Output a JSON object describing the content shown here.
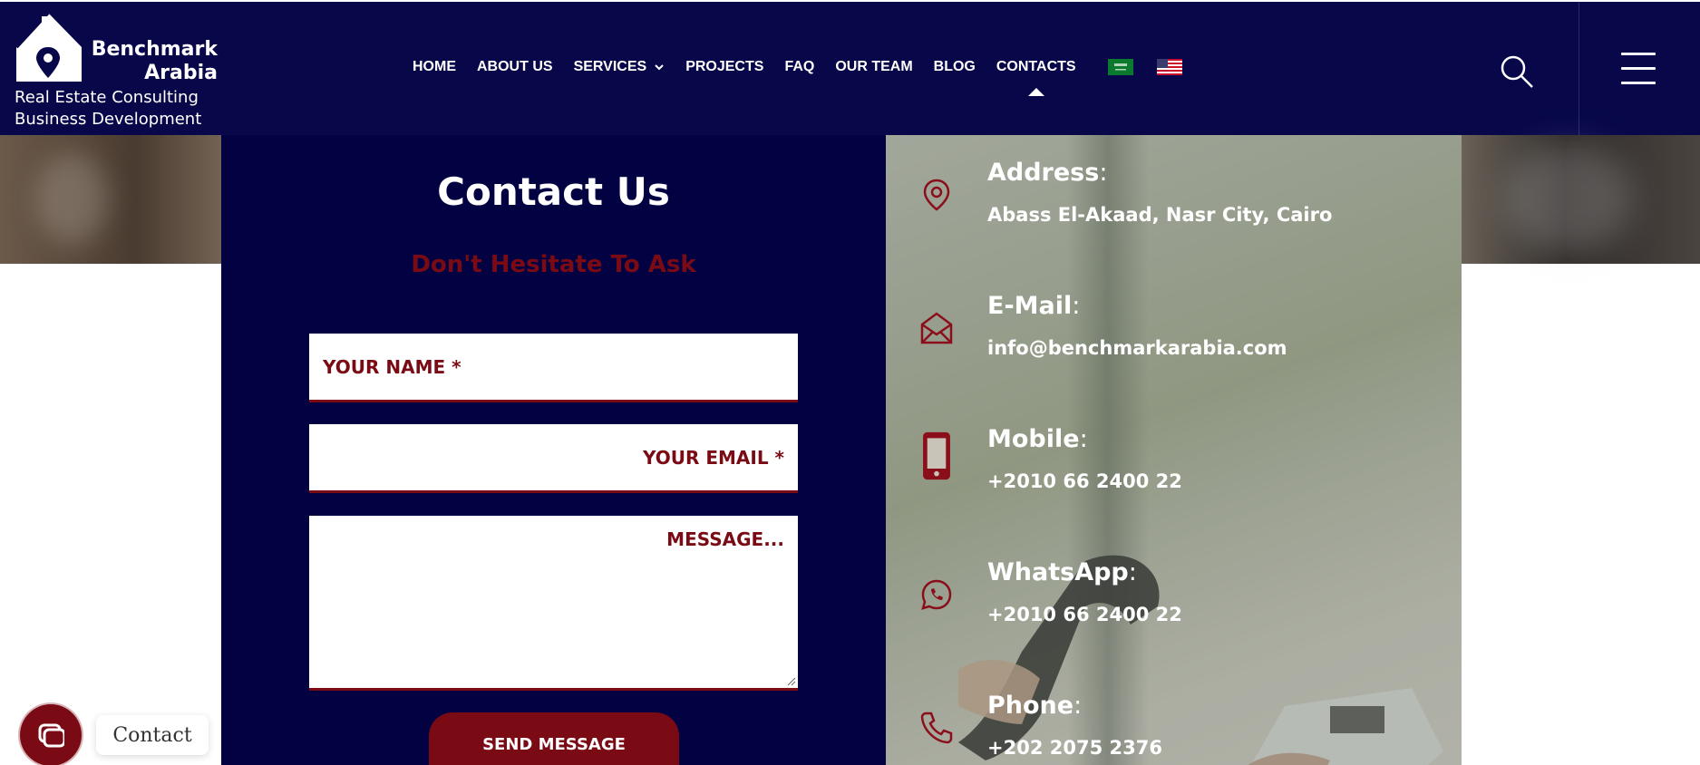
{
  "brand": {
    "name_line1": "Benchmark",
    "name_line2": "Arabia",
    "tagline_line1": "Real Estate Consulting",
    "tagline_line2": "Business Development"
  },
  "nav": {
    "items": [
      {
        "label": "HOME"
      },
      {
        "label": "ABOUT US"
      },
      {
        "label": "SERVICES"
      },
      {
        "label": "PROJECTS"
      },
      {
        "label": "FAQ"
      },
      {
        "label": "OUR TEAM"
      },
      {
        "label": "BLOG"
      },
      {
        "label": "CONTACTS"
      }
    ],
    "active": "CONTACTS",
    "flags": [
      "saudi-arabia-flag",
      "usa-flag"
    ]
  },
  "form": {
    "title": "Contact Us",
    "subtitle": "Don't Hesitate To Ask",
    "name_placeholder": "YOUR NAME *",
    "email_placeholder": "YOUR EMAIL *",
    "message_placeholder": "MESSAGE...",
    "submit_label": "SEND MESSAGE"
  },
  "info": {
    "address_label": "Address",
    "address_value": "Abass El-Akaad, Nasr City, Cairo",
    "email_label": "E-Mail",
    "email_value": "info@benchmarkarabia.com",
    "mobile_label": "Mobile",
    "mobile_value": "+2010 66 2400 22",
    "whatsapp_label": "WhatsApp",
    "whatsapp_value": "+2010 66 2400 22",
    "phone_label": "Phone",
    "phone_value": "+202 2075 2376"
  },
  "widget": {
    "label": "Contact"
  },
  "colors": {
    "navy": "#07074a",
    "panel": "#020243",
    "accent": "#7a0a14"
  }
}
